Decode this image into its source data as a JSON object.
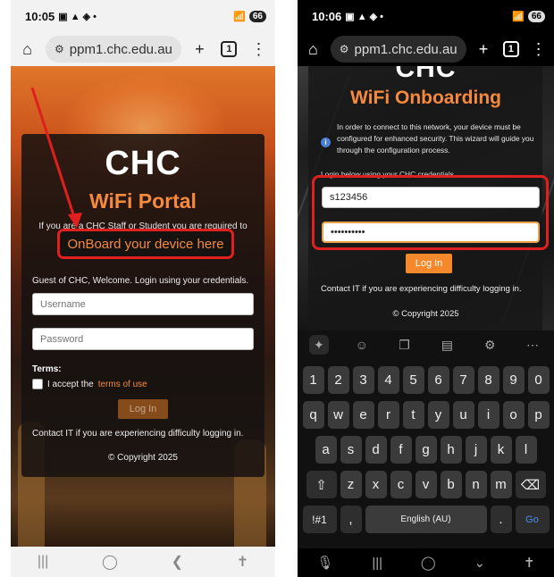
{
  "phone1": {
    "status": {
      "time": "10:05",
      "battery": "66"
    },
    "url": "ppm1.chc.edu.au",
    "tab_count": "1",
    "page": {
      "logo": "CHC",
      "title": "WiFi Portal",
      "intro": "If you are a CHC Staff or Student you are required to",
      "onboard_link": "OnBoard your device here",
      "guest_text": "Guest of CHC, Welcome. Login using your credentials.",
      "username_placeholder": "Username",
      "password_placeholder": "Password",
      "terms_label": "Terms:",
      "terms_prefix": "I accept the",
      "terms_link": "terms of use",
      "login_button": "Log In",
      "contact": "Contact IT if you are experiencing difficulty logging in.",
      "copyright": "© Copyright 2025"
    }
  },
  "phone2": {
    "status": {
      "time": "10:06",
      "battery": "66"
    },
    "url": "ppm1.chc.edu.au",
    "tab_count": "1",
    "page": {
      "logo": "CHC",
      "title": "WiFi Onboarding",
      "info": "In order to connect to this network, your device must be configured for enhanced security. This wizard will guide you through the configuration process.",
      "login_below": "Login below using your CHC credentials.",
      "username_value": "s123456",
      "password_value": "••••••••••",
      "login_button": "Log In",
      "contact": "Contact IT if you are experiencing difficulty logging in.",
      "copyright": "© Copyright 2025"
    },
    "keyboard": {
      "row_numbers": [
        "1",
        "2",
        "3",
        "4",
        "5",
        "6",
        "7",
        "8",
        "9",
        "0"
      ],
      "row1": [
        "q",
        "w",
        "e",
        "r",
        "t",
        "y",
        "u",
        "i",
        "o",
        "p"
      ],
      "row2": [
        "a",
        "s",
        "d",
        "f",
        "g",
        "h",
        "j",
        "k",
        "l"
      ],
      "row3": [
        "z",
        "x",
        "c",
        "v",
        "b",
        "n",
        "m"
      ],
      "symbols_key": "!#1",
      "comma_key": ",",
      "space_label": "English (AU)",
      "period_key": ".",
      "go_key": "Go"
    }
  },
  "colors": {
    "accent_orange": "#f58a3c",
    "highlight_red": "#e01f1f",
    "button_orange": "#f5882a"
  }
}
